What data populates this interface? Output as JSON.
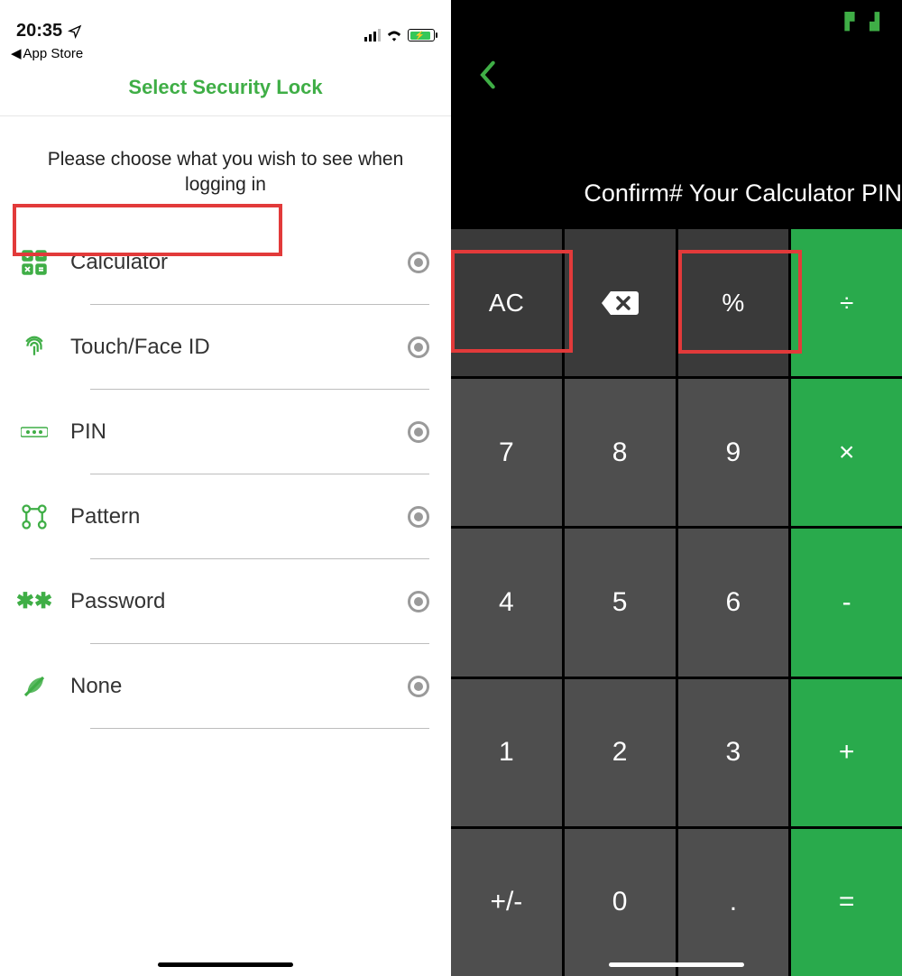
{
  "left": {
    "status": {
      "time": "20:35",
      "back_app": "App Store"
    },
    "header": "Select Security Lock",
    "prompt": "Please choose what you wish to see when logging in",
    "options": [
      {
        "label": "Calculator"
      },
      {
        "label": "Touch/Face ID"
      },
      {
        "label": "PIN"
      },
      {
        "label": "Pattern"
      },
      {
        "label": "Password"
      },
      {
        "label": "None"
      }
    ]
  },
  "right": {
    "status_icon": "⌈ ⌋",
    "title": "Confirm# Your Calculator PIN",
    "keys": {
      "ac": "AC",
      "pct": "%",
      "div": "÷",
      "k7": "7",
      "k8": "8",
      "k9": "9",
      "mul": "×",
      "k4": "4",
      "k5": "5",
      "k6": "6",
      "sub": "-",
      "k1": "1",
      "k2": "2",
      "k3": "3",
      "add": "+",
      "pm": "+/-",
      "k0": "0",
      "dot": ".",
      "eq": "="
    }
  },
  "colors": {
    "accent": "#3fae46",
    "op": "#29aa4c",
    "highlight": "#e23a3a"
  }
}
